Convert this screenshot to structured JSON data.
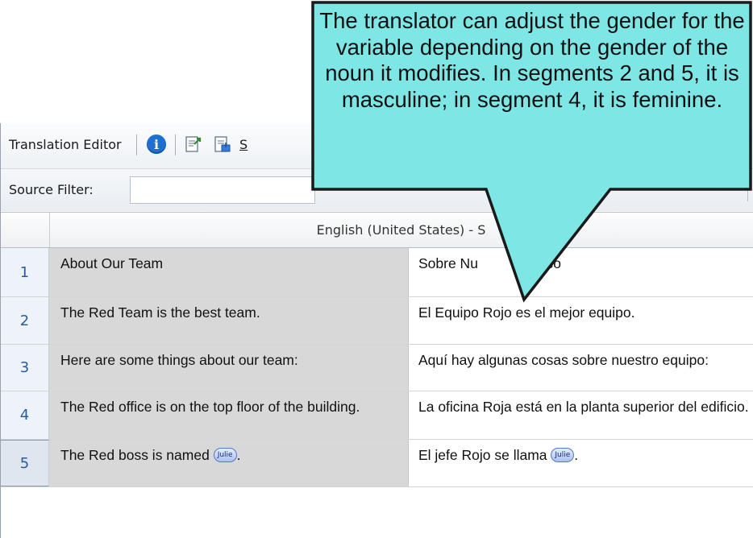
{
  "toolbar": {
    "title": "Translation Editor",
    "partial_label": "S"
  },
  "filter": {
    "label": "Source Filter:",
    "value": ""
  },
  "grid": {
    "header": "English (United States) - S",
    "rows": [
      {
        "num": "1",
        "source": "About Our Team",
        "target": "Sobre Nu          Equipo"
      },
      {
        "num": "2",
        "source": "The Red Team is the best team.",
        "target": "El Equipo Rojo es el mejor equipo."
      },
      {
        "num": "3",
        "source": "Here are some things about our team:",
        "target": "Aquí hay algunas cosas sobre nuestro equipo:"
      },
      {
        "num": "4",
        "source": "The Red office is on the top floor of the building.",
        "target": "La oficina Roja está en la planta superior del edificio."
      },
      {
        "num": "5",
        "source_before": "The Red boss is named ",
        "source_tag": "Julie",
        "source_after": ".",
        "target_before": "El jefe Rojo se llama ",
        "target_tag": "Julie",
        "target_after": "."
      }
    ]
  },
  "callout": {
    "text": "The translator can adjust the gender for the variable depending on the gender of the noun it modifies. In segments 2 and 5, it is masculine; in segment 4, it is feminine."
  },
  "colors": {
    "callout_fill": "#7fe6e6",
    "callout_border": "#1a1a1a",
    "source_cell": "#d8d8d8",
    "row_number": "#2a5b9a"
  }
}
